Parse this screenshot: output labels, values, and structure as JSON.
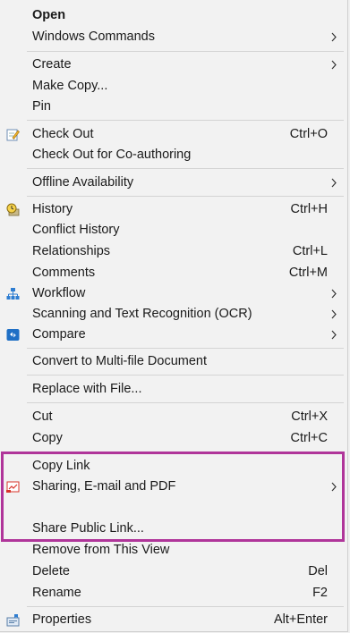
{
  "menu": {
    "open": "Open",
    "windows_commands": "Windows Commands",
    "create": "Create",
    "make_copy": "Make Copy...",
    "pin": "Pin",
    "check_out": "Check Out",
    "check_out_shortcut": "Ctrl+O",
    "check_out_coauthoring": "Check Out for Co-authoring",
    "offline_availability": "Offline Availability",
    "history": "History",
    "history_shortcut": "Ctrl+H",
    "conflict_history": "Conflict History",
    "relationships": "Relationships",
    "relationships_shortcut": "Ctrl+L",
    "comments": "Comments",
    "comments_shortcut": "Ctrl+M",
    "workflow": "Workflow",
    "scanning_ocr": "Scanning and Text Recognition (OCR)",
    "compare": "Compare",
    "convert_multifile": "Convert to Multi-file Document",
    "replace_with_file": "Replace with File...",
    "cut": "Cut",
    "cut_shortcut": "Ctrl+X",
    "copy": "Copy",
    "copy_shortcut": "Ctrl+C",
    "copy_link": "Copy Link",
    "sharing_email_pdf": "Sharing, E-mail and PDF",
    "share_public_link": "Share Public Link...",
    "remove_from_view": "Remove from This View",
    "delete": "Delete",
    "delete_shortcut": "Del",
    "rename": "Rename",
    "rename_shortcut": "F2",
    "properties": "Properties",
    "properties_shortcut": "Alt+Enter"
  },
  "highlight_color": "#b0359a",
  "icons": {
    "check_out": "edit-pencil-icon",
    "history": "history-clock-icon",
    "workflow": "workflow-icon",
    "compare": "compare-icon",
    "sharing": "share-pdf-icon",
    "properties": "properties-icon"
  }
}
